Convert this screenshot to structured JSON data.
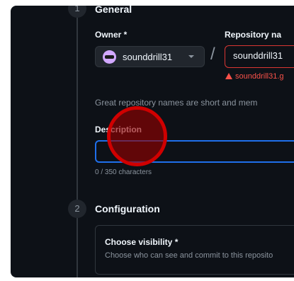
{
  "steps": [
    {
      "number": "1",
      "title": "General"
    },
    {
      "number": "2",
      "title": "Configuration"
    }
  ],
  "general": {
    "owner_label": "Owner *",
    "owner_value": "sounddrill31",
    "separator": "/",
    "repo_label": "Repository na",
    "repo_value": "sounddrill31",
    "repo_error": "sounddrill31.g",
    "hint": "Great repository names are short and mem",
    "description_label": "Description",
    "description_value": "",
    "char_count": "0 / 350 characters"
  },
  "configuration": {
    "visibility_title": "Choose visibility *",
    "visibility_sub": "Choose who can see and commit to this reposito"
  },
  "colors": {
    "background": "#0d1117",
    "error": "#f85149",
    "focus": "#1f6feb",
    "click_marker": "#d00000"
  }
}
